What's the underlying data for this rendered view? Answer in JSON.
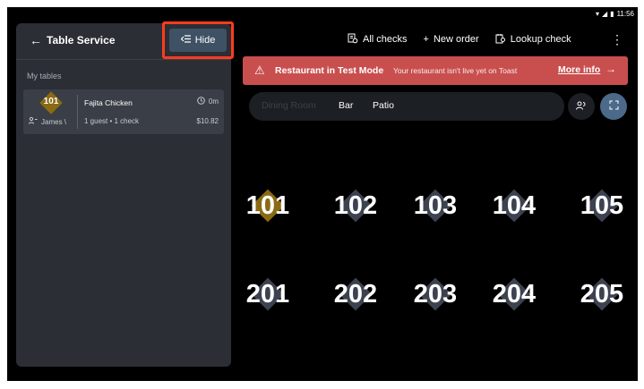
{
  "status": {
    "time": "11:56"
  },
  "panel": {
    "title": "Table Service",
    "hide_label": "Hide",
    "section_label": "My tables",
    "card": {
      "table_number": "101",
      "server": "James \\",
      "item": "Fajita Chicken",
      "elapsed": "0m",
      "guests": "1 guest • 1 check",
      "amount": "$10.82"
    }
  },
  "topbar": {
    "all_checks": "All checks",
    "new_order": "New order",
    "lookup_check": "Lookup check"
  },
  "banner": {
    "title": "Restaurant in Test Mode",
    "subtitle": "Your restaurant isn't live yet on Toast",
    "link": "More info"
  },
  "areas": [
    "Dining Room",
    "Bar",
    "Patio"
  ],
  "tables_row1": [
    "101",
    "102",
    "103",
    "104",
    "105"
  ],
  "tables_row2": [
    "201",
    "202",
    "203",
    "204",
    "205"
  ],
  "colors": {
    "accent": "#ff3b1f",
    "banner": "#c94f4f",
    "occupied": "#8a6a13",
    "table": "#3d4250"
  },
  "icons": [
    "wifi-icon",
    "signal-icon",
    "battery-icon",
    "back-arrow-icon",
    "collapse-icon",
    "guest-icon",
    "clock-icon",
    "checks-icon",
    "plus-icon",
    "lookup-icon",
    "kebab-icon",
    "warning-icon",
    "arrow-right-icon",
    "guests-filter-icon",
    "expand-icon"
  ]
}
